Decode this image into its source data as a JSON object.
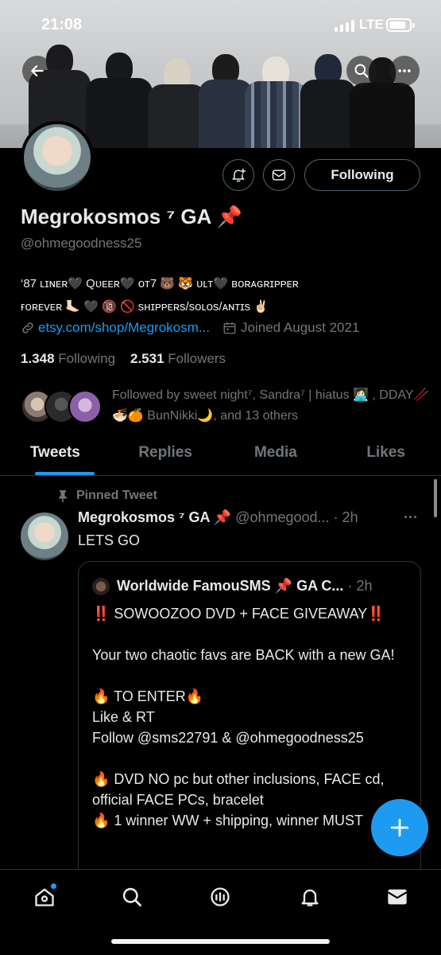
{
  "status_bar": {
    "time": "21:08",
    "network": "LTE"
  },
  "profile": {
    "display_name": "Megrokosmos ⁷ GA 📌",
    "handle": "@ohmegoodness25",
    "bio_line1": "‘87 ʟɪɴᴇʀ🖤 Qᴜᴇᴇʀ🖤 ᴏᴛ7 🐻 🐯 ᴜʟᴛ🖤 ʙᴏʀᴀɢʀɪᴘᴘᴇʀ",
    "bio_line2": "ғᴏʀᴇᴠᴇʀ 🦶🏻 🖤 🔞 🚫 sʜɪᴘᴘᴇʀs/sᴏʟᴏs/ᴀɴᴛɪs ✌🏻",
    "link": "etsy.com/shop/Megrokosm...",
    "joined": "Joined August 2021",
    "following_count": "1.348",
    "following_label": "Following",
    "followers_count": "2.531",
    "followers_label": "Followers",
    "followed_by": "Followed by sweet night⁷, Sandra⁷ | hiatus 👩🏻‍💻 , DDAY🥢🍜🍊 BunNikki🌙, and 13 others",
    "following_button": "Following"
  },
  "tabs": [
    {
      "label": "Tweets",
      "active": true
    },
    {
      "label": "Replies",
      "active": false
    },
    {
      "label": "Media",
      "active": false
    },
    {
      "label": "Likes",
      "active": false
    }
  ],
  "tweet": {
    "pinned_label": "Pinned Tweet",
    "name": "Megrokosmos ⁷ GA 📌",
    "handle_time": "@ohmegood... · 2h",
    "more": "···",
    "text": "LETS GO",
    "quote": {
      "name": "Worldwide FamouSMS 📌 GA C...",
      "time": "· 2h",
      "body": "‼️ SOWOOZOO DVD + FACE GIVEAWAY‼️\n\nYour two chaotic favs are BACK with a new GA!\n\n🔥 TO ENTER🔥\nLike & RT\nFollow @sms22791 & @ohmegoodness25\n\n🔥 DVD NO pc but other inclusions, FACE cd, official FACE PCs, bracelet\n🔥 1 winner WW + shipping, winner MUST"
    }
  },
  "colors": {
    "accent": "#1d9bf0",
    "muted": "#71767b",
    "text": "#e7e9ea",
    "border": "#2f3336"
  }
}
